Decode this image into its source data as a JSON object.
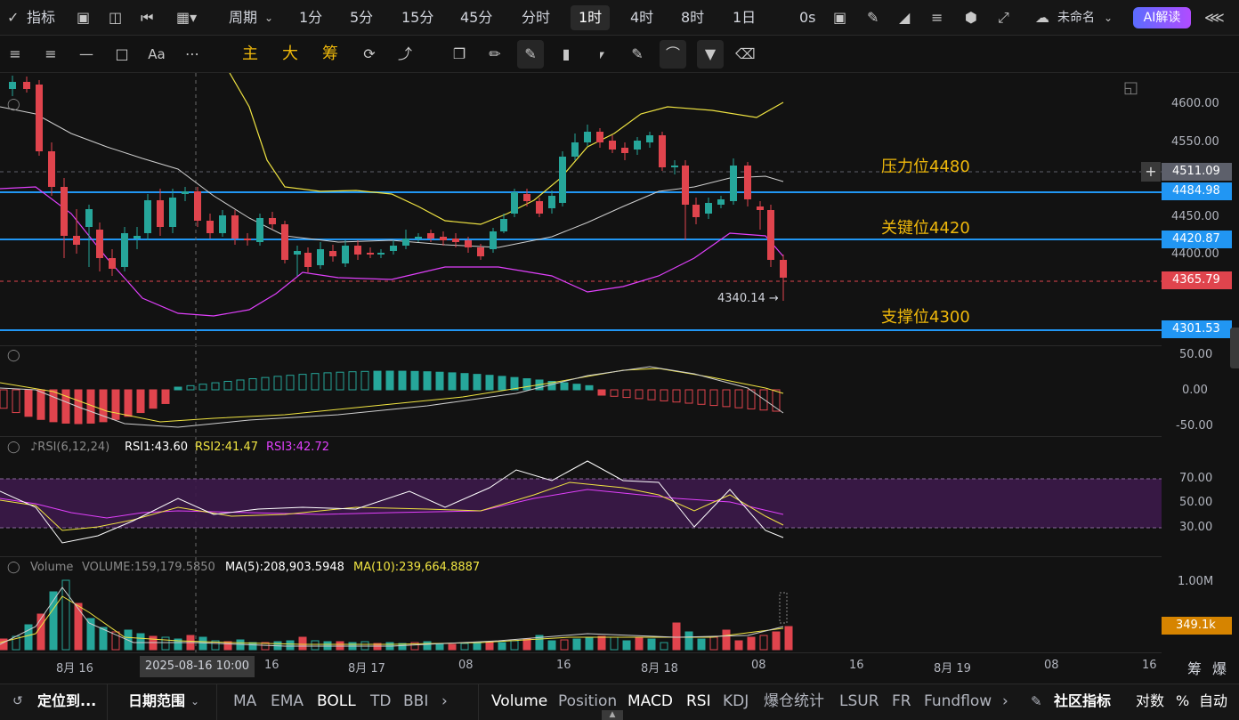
{
  "topbar": {
    "indicators_label": "指标",
    "period_label": "周期",
    "timeframes": [
      "1分",
      "5分",
      "15分",
      "45分",
      "分时",
      "1时",
      "4时",
      "8时",
      "1日"
    ],
    "active_timeframe": "1时",
    "countdown": "0s",
    "layout_name": "未命名",
    "ai_label": "AI解读"
  },
  "drawbar": {
    "main_label": "主",
    "big_label": "大",
    "chip_label": "筹",
    "text_tool": "Aa"
  },
  "price_pane": {
    "axis_labels": [
      "4600.00",
      "4550.00",
      "4450.00",
      "4400.00"
    ],
    "price_tags": [
      {
        "text": "4511.09",
        "color": "#5d606b"
      },
      {
        "text": "4484.98",
        "color": "#2196f3"
      },
      {
        "text": "4420.87",
        "color": "#2196f3"
      },
      {
        "text": "4365.79",
        "color": "#e0444d"
      },
      {
        "text": "4301.53",
        "color": "#2196f3"
      }
    ],
    "annotations": [
      "压力位4480",
      "关键位4420",
      "支撑位4300"
    ],
    "low_marker": "4340.14",
    "annotation_color": "#f0b90b"
  },
  "macd_pane": {
    "axis_labels": [
      "50.00",
      "0.00",
      "-50.00"
    ]
  },
  "rsi_pane": {
    "name": "RSI(6,12,24)",
    "rsi1": "RSI1:43.60",
    "rsi2": "RSI2:41.47",
    "rsi3": "RSI3:42.72",
    "axis_labels": [
      "70.00",
      "50.00",
      "30.00"
    ],
    "colors": {
      "rsi1": "#ffffff",
      "rsi2": "#f0e442",
      "rsi3": "#e040fb"
    }
  },
  "volume_pane": {
    "name": "Volume",
    "volume": "VOLUME:159,179.5850",
    "ma5": "MA(5):208,903.5948",
    "ma10": "MA(10):239,664.8887",
    "axis_label": "1.00M",
    "tag": "349.1k"
  },
  "xaxis": {
    "labels": [
      {
        "text": "8月 16"
      },
      {
        "text": "16"
      },
      {
        "text": "8月 17"
      },
      {
        "text": "08"
      },
      {
        "text": "16"
      },
      {
        "text": "8月 18"
      },
      {
        "text": "08"
      },
      {
        "text": "16"
      },
      {
        "text": "8月 19"
      },
      {
        "text": "08"
      },
      {
        "text": "16"
      }
    ],
    "crosshair_label": "2025-08-16 10:00",
    "right_labels": [
      "筹",
      "爆"
    ]
  },
  "bottombar": {
    "locate": "定位到...",
    "date_range": "日期范围",
    "main_indicators": [
      "MA",
      "EMA",
      "BOLL",
      "TD",
      "BBI"
    ],
    "sub_indicators": [
      "Volume",
      "Position",
      "MACD",
      "RSI",
      "KDJ",
      "爆仓统计",
      "LSUR",
      "FR",
      "Fundflow"
    ],
    "community": "社区指标",
    "log_label": "对数",
    "percent_label": "%",
    "auto_label": "自动"
  }
}
